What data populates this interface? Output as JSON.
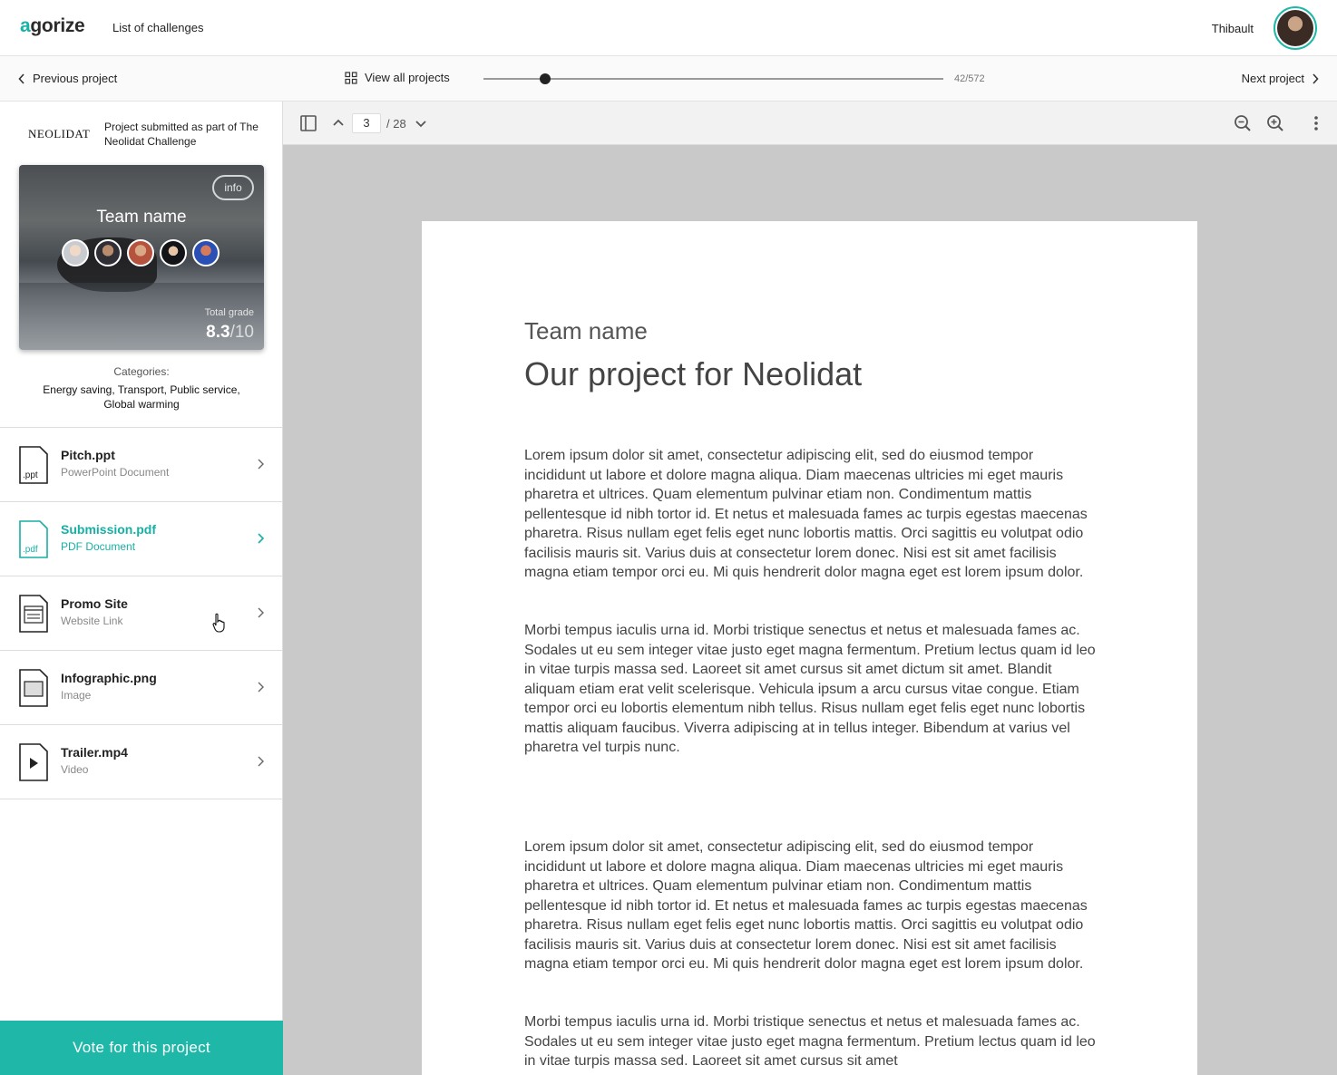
{
  "header": {
    "logo_prefix": "a",
    "logo_rest": "gorize",
    "nav_link": "List of challenges",
    "user_name": "Thibault"
  },
  "project_nav": {
    "previous": "Previous project",
    "view_all": "View all projects",
    "counter": "42/572",
    "next": "Next project",
    "position_fraction": 0.1339
  },
  "sidebar": {
    "brand": "NEOLIDAT",
    "submitted_text": "Project submitted as part of The Neolidat Challenge",
    "card": {
      "info": "info",
      "team_name": "Team name",
      "grade_label": "Total grade",
      "grade_value": "8.3",
      "grade_max": "/10"
    },
    "categories_label": "Categories:",
    "categories": "Energy saving, Transport, Public service, Global warming",
    "files": [
      {
        "name": "Pitch.ppt",
        "type": "PowerPoint Document",
        "ext": ".ppt"
      },
      {
        "name": "Submission.pdf",
        "type": "PDF Document",
        "ext": ".pdf"
      },
      {
        "name": "Promo Site",
        "type": "Website Link"
      },
      {
        "name": "Infographic.png",
        "type": "Image"
      },
      {
        "name": "Trailer.mp4",
        "type": "Video"
      }
    ],
    "vote_button": "Vote for this project"
  },
  "viewer": {
    "page_current": "3",
    "page_total": "/ 28",
    "doc_subtitle": "Team name",
    "doc_title": "Our project for Neolidat",
    "paragraphs": [
      "Lorem ipsum dolor sit amet, consectetur adipiscing elit, sed do eiusmod tempor incididunt ut labore et dolore magna aliqua. Diam maecenas ultricies mi eget mauris pharetra et ultrices. Quam elementum pulvinar etiam non. Condimentum mattis pellentesque id nibh tortor id. Et netus et malesuada fames ac turpis egestas maecenas pharetra. Risus nullam eget felis eget nunc lobortis mattis. Orci sagittis eu volutpat odio facilisis mauris sit. Varius duis at consectetur lorem donec. Nisi est sit amet facilisis magna etiam tempor orci eu. Mi quis hendrerit dolor magna eget est lorem ipsum dolor.",
      "Morbi tempus iaculis urna id. Morbi tristique senectus et netus et malesuada fames ac. Sodales ut eu sem integer vitae justo eget magna fermentum. Pretium lectus quam id leo in vitae turpis massa sed. Laoreet sit amet cursus sit amet dictum sit amet. Blandit aliquam etiam erat velit scelerisque. Vehicula ipsum a arcu cursus vitae congue. Etiam tempor orci eu lobortis elementum nibh tellus. Risus nullam eget felis eget nunc lobortis mattis aliquam faucibus. Viverra adipiscing at in tellus integer. Bibendum at varius vel pharetra vel turpis nunc.",
      "Lorem ipsum dolor sit amet, consectetur adipiscing elit, sed do eiusmod tempor incididunt ut labore et dolore magna aliqua. Diam maecenas ultricies mi eget mauris pharetra et ultrices. Quam elementum pulvinar etiam non. Condimentum mattis pellentesque id nibh tortor id. Et netus et malesuada fames ac turpis egestas maecenas pharetra. Risus nullam eget felis eget nunc lobortis mattis. Orci sagittis eu volutpat odio facilisis mauris sit. Varius duis at consectetur lorem donec. Nisi est sit amet facilisis magna etiam tempor orci eu. Mi quis hendrerit dolor magna eget est lorem ipsum dolor.",
      "Morbi tempus iaculis urna id. Morbi tristique senectus et netus et malesuada fames ac. Sodales ut eu sem integer vitae justo eget magna fermentum. Pretium lectus quam id leo in vitae turpis massa sed. Laoreet sit amet cursus sit amet"
    ]
  },
  "colors": {
    "accent": "#1fb8a8",
    "viewer_bg": "#c8c9c8"
  },
  "icons": [
    "chevron-left-icon",
    "grid-icon",
    "chevron-right-icon",
    "sidebar-toggle-icon",
    "chevron-up-icon",
    "chevron-down-icon",
    "zoom-out-icon",
    "zoom-in-icon",
    "more-vertical-icon",
    "pointer-cursor-icon"
  ]
}
